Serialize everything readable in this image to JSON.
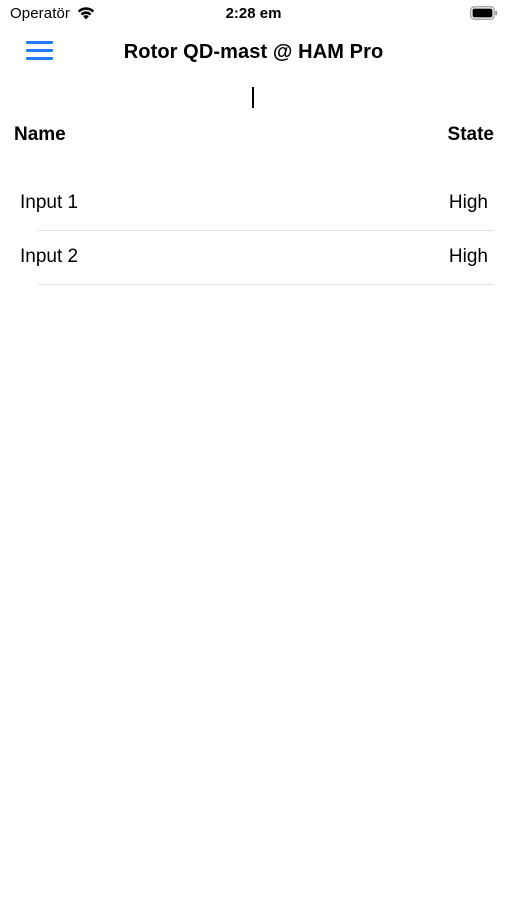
{
  "status_bar": {
    "carrier": "Operatör",
    "time": "2:28 em",
    "wifi_icon": "wifi-icon",
    "battery_icon": "battery-icon"
  },
  "nav": {
    "title": "Rotor QD-mast @ HAM Pro",
    "menu_icon": "hamburger-menu-icon",
    "accent_color": "#1b7cf5"
  },
  "table": {
    "headers": {
      "name": "Name",
      "state": "State"
    },
    "rows": [
      {
        "name": "Input 1",
        "state": "High"
      },
      {
        "name": "Input 2",
        "state": "High"
      }
    ]
  }
}
